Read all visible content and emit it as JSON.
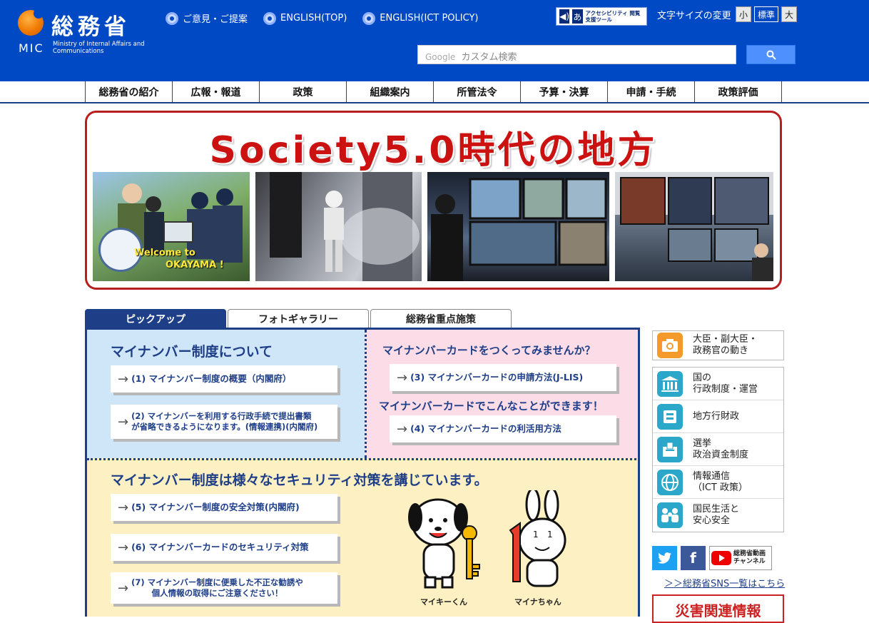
{
  "header": {
    "logo_title": "総務省",
    "logo_mic": "MIC",
    "logo_sub": "Ministry of Internal Affairs and Communications",
    "links": [
      "ご意見・ご提案",
      "ENGLISH(TOP)",
      "ENGLISH(ICT POLICY)"
    ],
    "accessibility": "アクセシビリティ 閲覧支援ツール",
    "font_size_label": "文字サイズの変更",
    "font_sizes": [
      "小",
      "標準",
      "大"
    ],
    "font_size_selected": "標準",
    "search_google": "Google",
    "search_placeholder": "カスタム検索"
  },
  "nav": [
    "総務省の紹介",
    "広報・報道",
    "政策",
    "組織案内",
    "所管法令",
    "予算・決算",
    "申請・手続",
    "政策評価"
  ],
  "banner": {
    "title": "Society5.0時代の地方",
    "welcome_line1": "Welcome to",
    "welcome_line2": "OKAYAMA !"
  },
  "tabs": [
    "ピックアップ",
    "フォトギャラリー",
    "総務省重点施策"
  ],
  "tab_selected": "ピックアップ",
  "pickup": {
    "blue_title": "マイナンバー制度について",
    "blue_links": [
      "(1) マイナンバー制度の概要（内閣府）",
      "(2) マイナンバーを利用する行政手続で提出書類\nが省略できるようになります。(情報連携)(内閣府)"
    ],
    "pink_title1": "マイナンバーカードをつくってみませんか？",
    "pink_link1": "(3) マイナンバーカードの申請方法(J-LIS)",
    "pink_title2": "マイナンバーカードでこんなことができます！",
    "pink_link2": "(4) マイナンバーカードの利活用方法",
    "yellow_title": "マイナンバー制度は様々なセキュリティ対策を講じています。",
    "yellow_links": [
      "(5) マイナンバー制度の安全対策(内閣府)",
      "(6) マイナンバーカードのセキュリティ対策",
      "(7) マイナンバー制度に便乗した不正な勧誘や\n個人情報の取得にご注意ください！"
    ],
    "mascots": [
      "マイキーくん",
      "マイナちゃん"
    ]
  },
  "sidebar": {
    "minister": "大臣・副大臣・\n政務官の動き",
    "items": [
      "国の\n行政制度・運営",
      "地方行財政",
      "選挙\n政治資金制度",
      "情報通信\n（ICT 政策）",
      "国民生活と\n安心安全"
    ],
    "youtube": "総務省動画\nチャンネル",
    "sns_link": "＞＞総務省SNS一覧はこちら",
    "disaster": "災害関連情報"
  },
  "colors": {
    "header_blue": "#0049c4",
    "nav_line": "#1e3e88",
    "banner_red": "#cc1111",
    "accent_orange": "#f39a2a",
    "accent_teal": "#2aa7c9"
  }
}
